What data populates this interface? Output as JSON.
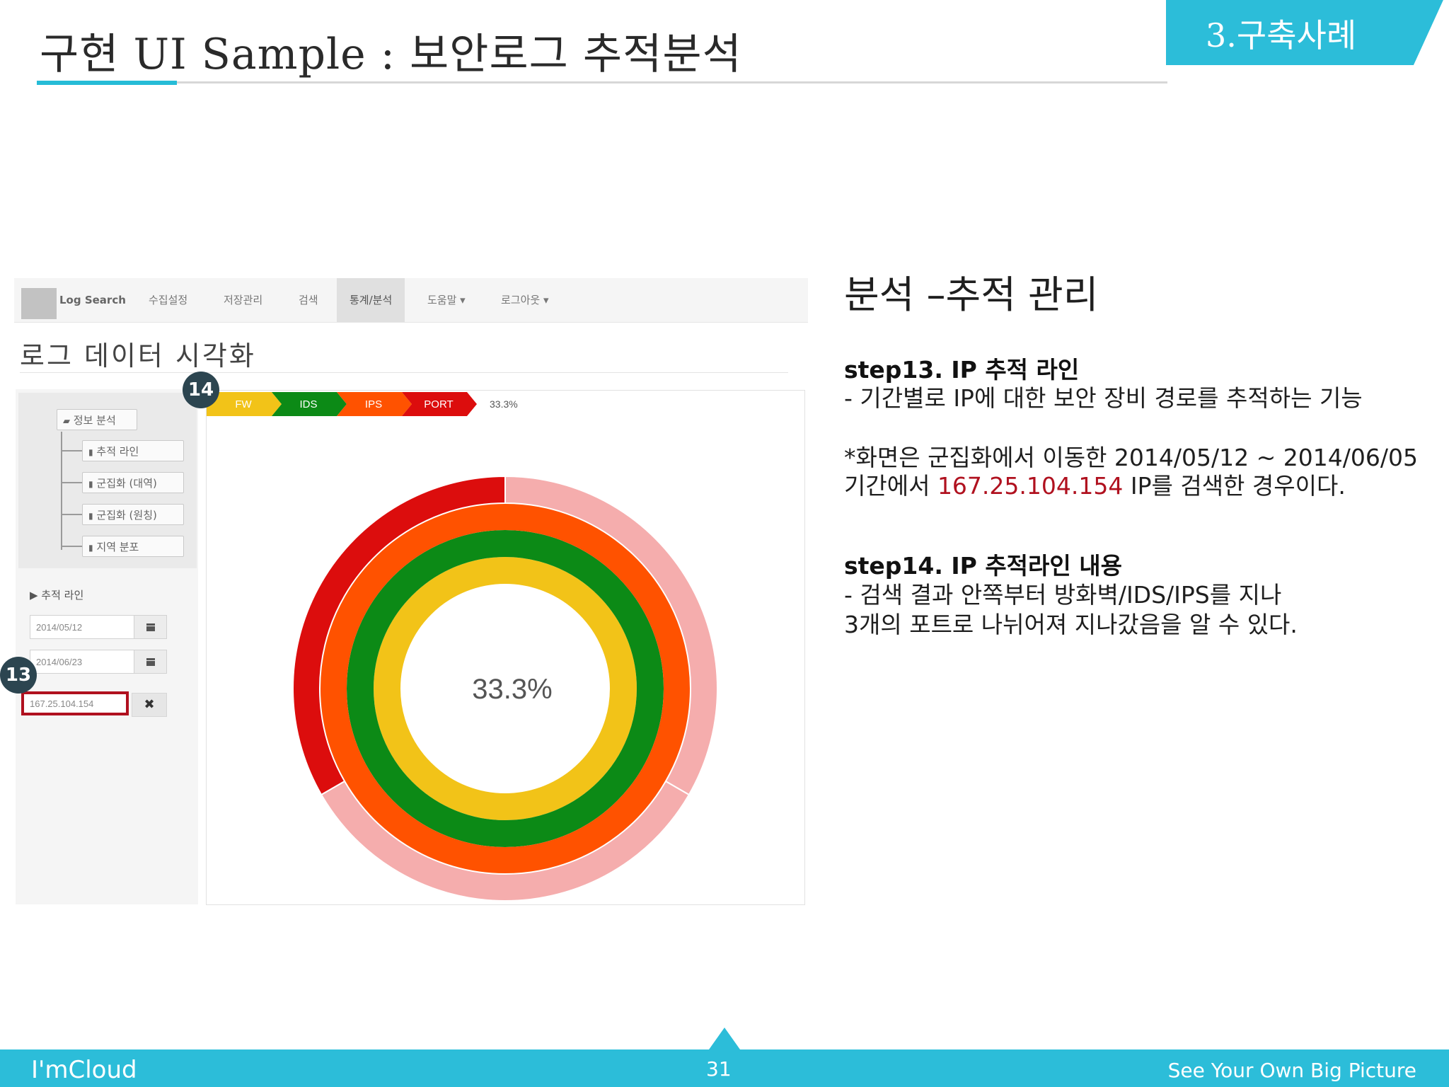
{
  "slide": {
    "title": "구현 UI Sample : 보안로그 추적분석",
    "section": "3.구축사례"
  },
  "app": {
    "nav": {
      "brand": "Log Search",
      "items": [
        {
          "label": "수집설정"
        },
        {
          "label": "저장관리"
        },
        {
          "label": "검색"
        },
        {
          "label": "통계/분석",
          "active": true
        },
        {
          "label": "도움말 ▾"
        },
        {
          "label": "로그아웃 ▾"
        }
      ]
    },
    "view_title": "로그 데이터 시각화",
    "sidebar": {
      "tree": {
        "root": "정보 분석",
        "children": [
          "추적 라인",
          "군집화 (대역)",
          "군집화 (원칭)",
          "지역 분포"
        ]
      },
      "trace": {
        "header": "▶ 추적 라인",
        "start_date": "2014/05/12",
        "end_date": "2014/06/23",
        "ip": "167.25.104.154",
        "clear": "✖"
      }
    },
    "markers": {
      "m14": "14",
      "m13": "13"
    }
  },
  "chart_data": {
    "type": "sunburst",
    "breadcrumb": [
      {
        "label": "FW",
        "color": "#f2c318"
      },
      {
        "label": "IDS",
        "color": "#0c8a16"
      },
      {
        "label": "IPS",
        "color": "#ff5200"
      },
      {
        "label": "PORT",
        "color": "#dc0d0d"
      }
    ],
    "breadcrumb_value": "33.3%",
    "center_label": "33.3%",
    "rings": [
      {
        "name": "FW",
        "color": "#f2c318",
        "highlight_fraction": 1.0,
        "remainder_color": "#f2c318"
      },
      {
        "name": "IDS",
        "color": "#0c8a16",
        "highlight_fraction": 1.0,
        "remainder_color": "#0c8a16"
      },
      {
        "name": "IPS",
        "color": "#ff5200",
        "highlight_fraction": 1.0,
        "remainder_color": "#ff5200"
      },
      {
        "name": "PORT",
        "color": "#dc0d0d",
        "highlight_fraction": 0.333,
        "remainder_color": "#f5adad",
        "slices": 3
      }
    ]
  },
  "description": {
    "heading": "분석 –추적 관리",
    "step13": {
      "title": "step13. IP 추적 라인",
      "line1": " - 기간별로 IP에 대한 보안 장비 경로를 추적하는 기능",
      "note_line1": "*화면은 군집화에서 이동한 2014/05/12 ~ 2014/06/05",
      "note_line2_pre": "기간에서 ",
      "note_ip": "167.25.104.154",
      "note_line2_post": " IP를 검색한 경우이다."
    },
    "step14": {
      "title": "step14. IP 추적라인 내용",
      "line1": " - 검색 결과 안쪽부터 방화벽/IDS/IPS를 지나",
      "line2": "3개의 포트로 나뉘어져 지나갔음을 알 수 있다."
    }
  },
  "footer": {
    "brand": "I'mCloud",
    "page": "31",
    "tagline": "See Your Own Big Picture"
  }
}
